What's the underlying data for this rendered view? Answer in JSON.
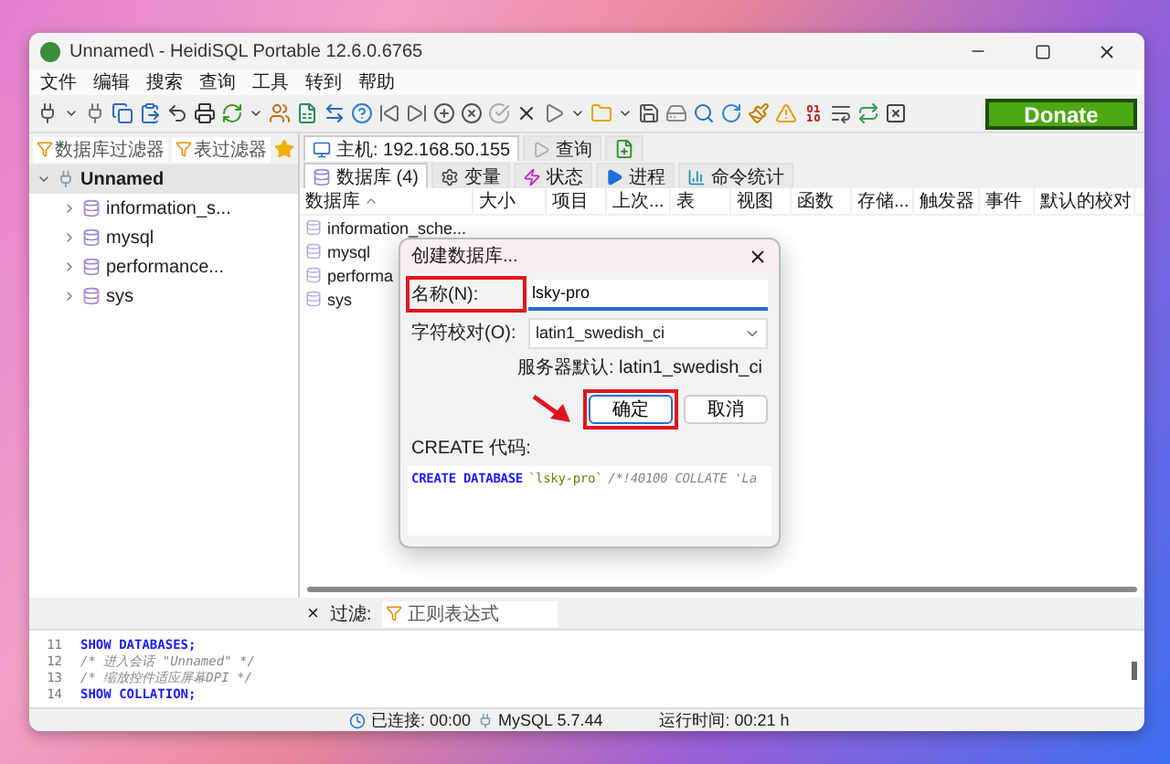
{
  "window": {
    "title": "Unnamed\\ - HeidiSQL Portable 12.6.0.6765"
  },
  "menu": [
    "文件",
    "编辑",
    "搜索",
    "查询",
    "工具",
    "转到",
    "帮助"
  ],
  "donate": "Donate",
  "left_filters": [
    {
      "placeholder": "数据库过滤器"
    },
    {
      "placeholder": "表过滤器"
    }
  ],
  "tree": [
    {
      "label": "Unnamed",
      "expanded": true,
      "selected": true,
      "children": [
        {
          "label": "information_s...",
          "expanded": false,
          "selected": false
        },
        {
          "label": "mysql",
          "expanded": false,
          "selected": false
        },
        {
          "label": "performance...",
          "expanded": false,
          "selected": false
        },
        {
          "label": "sys",
          "expanded": false,
          "selected": false
        }
      ]
    }
  ],
  "host_tabs": [
    {
      "label": "主机: 192.168.50.155",
      "kind": "host",
      "selected": true
    },
    {
      "label": "查询",
      "kind": "query",
      "selected": false
    },
    {
      "kind": "add",
      "selected": false
    }
  ],
  "sub_tabs": [
    {
      "label": "数据库 (4)",
      "kind": "db",
      "selected": true
    },
    {
      "label": "变量",
      "kind": "gear",
      "selected": false
    },
    {
      "label": "状态",
      "kind": "bolt",
      "selected": false
    },
    {
      "label": "进程",
      "kind": "play",
      "selected": false
    },
    {
      "label": "命令统计",
      "kind": "chart",
      "selected": false
    }
  ],
  "table": {
    "columns": [
      "数据库",
      "大小",
      "项目",
      "上次...",
      "表",
      "视图",
      "函数",
      "存储...",
      "触发器",
      "事件",
      "默认的校对"
    ],
    "rows": [
      "information_sche...",
      "mysql",
      "performa",
      "sys"
    ]
  },
  "dialog": {
    "title": "创建数据库...",
    "name_label": "名称(N):",
    "name_value": "lsky-pro",
    "collation_label": "字符校对(O):",
    "collation_value": "latin1_swedish_ci",
    "server_default": "服务器默认: latin1_swedish_ci",
    "ok": "确定",
    "cancel": "取消",
    "code_label": "CREATE 代码:",
    "code": [
      {
        "kind": "keyword",
        "text": "CREATE DATABASE"
      },
      {
        "kind": "string",
        "text": "`lsky-pro`"
      },
      {
        "kind": "comment",
        "text": "/*!40100 COLLATE 'La"
      }
    ]
  },
  "filter_bar": {
    "close": "×",
    "label": "过滤:",
    "placeholder": "正则表达式"
  },
  "log": [
    {
      "num": "11",
      "kind": "keyword",
      "text": "SHOW DATABASES;"
    },
    {
      "num": "12",
      "kind": "comment",
      "text": "/* 进入会话 \"Unnamed\" */"
    },
    {
      "num": "13",
      "kind": "comment",
      "text": "/* 缩放控件适应屏幕DPI */"
    },
    {
      "num": "14",
      "kind": "keyword",
      "text": "SHOW COLLATION;"
    }
  ],
  "status_bar": {
    "connected": "已连接: 00:00",
    "server": "MySQL 5.7.44",
    "uptime": "运行时间: 00:21 h"
  }
}
